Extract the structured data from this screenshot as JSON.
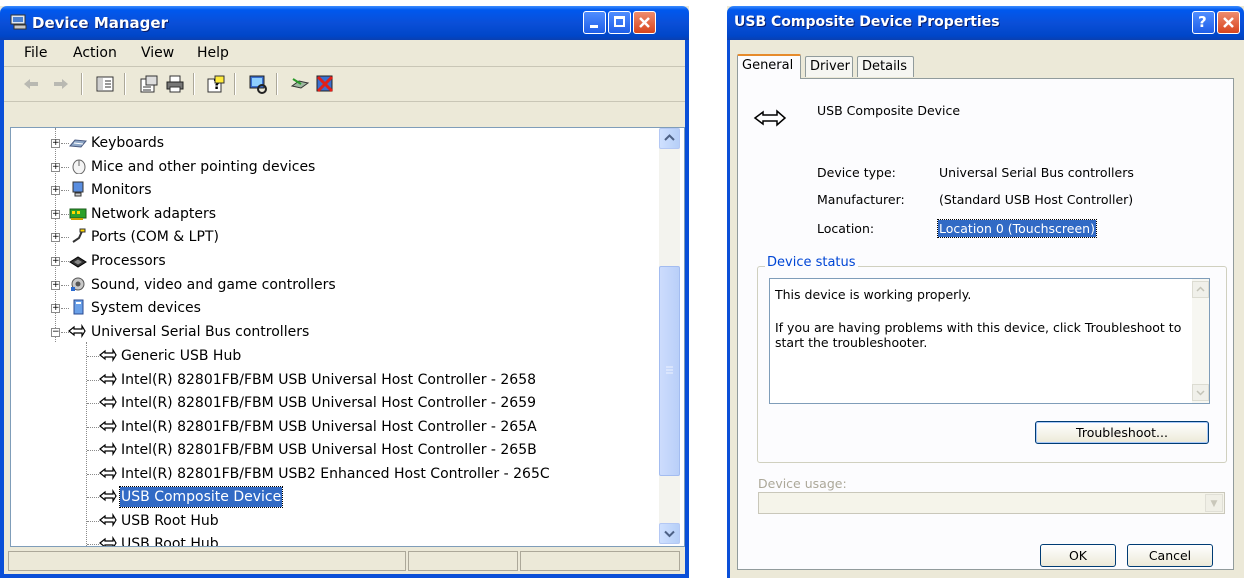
{
  "device_manager": {
    "title": "Device Manager",
    "menu": [
      {
        "label": "File"
      },
      {
        "label": "Action"
      },
      {
        "label": "View"
      },
      {
        "label": "Help"
      }
    ],
    "toolbar_icons": [
      "back-icon",
      "forward-icon",
      "show-hide-console-tree-icon",
      "properties-icon",
      "print-icon",
      "help-icon",
      "scan-hardware-icon",
      "update-driver-icon",
      "uninstall-icon"
    ],
    "tree": {
      "categories": [
        {
          "label": "Keyboards",
          "icon": "keyboard-icon",
          "expanded": false
        },
        {
          "label": "Mice and other pointing devices",
          "icon": "mouse-icon",
          "expanded": false
        },
        {
          "label": "Monitors",
          "icon": "monitor-icon",
          "expanded": false
        },
        {
          "label": "Network adapters",
          "icon": "network-adapter-icon",
          "expanded": false
        },
        {
          "label": "Ports (COM & LPT)",
          "icon": "port-icon",
          "expanded": false
        },
        {
          "label": "Processors",
          "icon": "processor-icon",
          "expanded": false
        },
        {
          "label": "Sound, video and game controllers",
          "icon": "sound-icon",
          "expanded": false
        },
        {
          "label": "System devices",
          "icon": "system-device-icon",
          "expanded": false
        },
        {
          "label": "Universal Serial Bus controllers",
          "icon": "usb-icon",
          "expanded": true
        }
      ],
      "usb_children": [
        {
          "label": "Generic USB Hub",
          "selected": false
        },
        {
          "label": "Intel(R) 82801FB/FBM USB Universal Host Controller - 2658",
          "selected": false
        },
        {
          "label": "Intel(R) 82801FB/FBM USB Universal Host Controller - 2659",
          "selected": false
        },
        {
          "label": "Intel(R) 82801FB/FBM USB Universal Host Controller - 265A",
          "selected": false
        },
        {
          "label": "Intel(R) 82801FB/FBM USB Universal Host Controller - 265B",
          "selected": false
        },
        {
          "label": "Intel(R) 82801FB/FBM USB2 Enhanced Host Controller - 265C",
          "selected": false
        },
        {
          "label": "USB Composite Device",
          "selected": true
        },
        {
          "label": "USB Root Hub",
          "selected": false
        },
        {
          "label": "USB Root Hub",
          "selected": false
        }
      ]
    }
  },
  "properties": {
    "title": "USB Composite Device Properties",
    "tabs": [
      {
        "label": "General",
        "active": true
      },
      {
        "label": "Driver",
        "active": false
      },
      {
        "label": "Details",
        "active": false
      }
    ],
    "device_name": "USB Composite Device",
    "fields": [
      {
        "label": "Device type:",
        "value": "Universal Serial Bus controllers"
      },
      {
        "label": "Manufacturer:",
        "value": "(Standard USB Host Controller)"
      },
      {
        "label": "Location:",
        "value": "Location 0 (Touchscreen)"
      }
    ],
    "status_group_label": "Device status",
    "status_line1": "This device is working properly.",
    "status_line2": "If you are having problems with this device, click Troubleshoot to start the troubleshooter.",
    "troubleshoot_label": "Troubleshoot...",
    "device_usage_label": "Device usage:",
    "device_usage_value": "",
    "ok_label": "OK",
    "cancel_label": "Cancel"
  },
  "colors": {
    "titlebar": "#0a4fd8",
    "selection": "#316ac5",
    "group_label": "#0046d5",
    "window_face": "#ece9d8"
  }
}
